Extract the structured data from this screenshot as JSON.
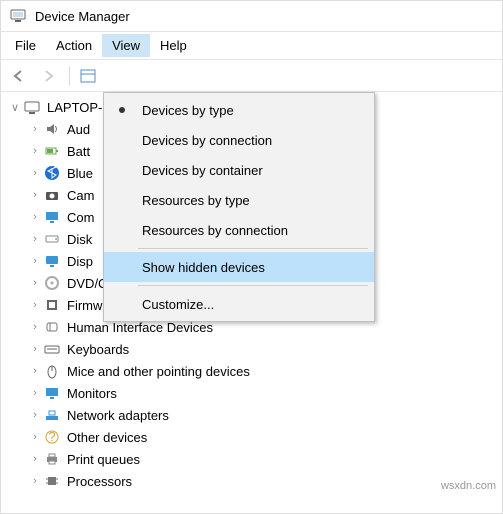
{
  "window": {
    "title": "Device Manager"
  },
  "menubar": {
    "items": [
      "File",
      "Action",
      "View",
      "Help"
    ],
    "open_index": 2
  },
  "view_menu": {
    "items": [
      {
        "label": "Devices by type",
        "selected": true
      },
      {
        "label": "Devices by connection",
        "selected": false
      },
      {
        "label": "Devices by container",
        "selected": false
      },
      {
        "label": "Resources by type",
        "selected": false
      },
      {
        "label": "Resources by connection",
        "selected": false
      }
    ],
    "show_hidden": {
      "label": "Show hidden devices",
      "highlight": true
    },
    "customize": {
      "label": "Customize..."
    }
  },
  "tree": {
    "root": {
      "label": "LAPTOP-",
      "expanded": true
    },
    "children": [
      {
        "label": "Aud",
        "icon": "audio"
      },
      {
        "label": "Batt",
        "icon": "battery"
      },
      {
        "label": "Blue",
        "icon": "bluetooth"
      },
      {
        "label": "Cam",
        "icon": "camera"
      },
      {
        "label": "Com",
        "icon": "computer"
      },
      {
        "label": "Disk",
        "icon": "disk"
      },
      {
        "label": "Disp",
        "icon": "display"
      },
      {
        "label": "DVD/CD-ROM drives",
        "icon": "dvd"
      },
      {
        "label": "Firmware",
        "icon": "firmware"
      },
      {
        "label": "Human Interface Devices",
        "icon": "hid"
      },
      {
        "label": "Keyboards",
        "icon": "keyboard"
      },
      {
        "label": "Mice and other pointing devices",
        "icon": "mouse"
      },
      {
        "label": "Monitors",
        "icon": "monitor"
      },
      {
        "label": "Network adapters",
        "icon": "network"
      },
      {
        "label": "Other devices",
        "icon": "other"
      },
      {
        "label": "Print queues",
        "icon": "printer"
      },
      {
        "label": "Processors",
        "icon": "processor"
      }
    ]
  },
  "watermark": "wsxdn.com",
  "icons": {
    "computer": "#3a95d6",
    "audio": "#777",
    "battery": "#6aa84f",
    "bluetooth": "#1f6fd0",
    "camera": "#555",
    "disk": "#888",
    "display": "#3a95d6",
    "dvd": "#aaa",
    "firmware": "#666",
    "hid": "#777",
    "keyboard": "#666",
    "mouse": "#666",
    "monitor": "#3a95d6",
    "network": "#3a95d6",
    "other": "#d4a13b",
    "printer": "#888",
    "processor": "#777"
  }
}
